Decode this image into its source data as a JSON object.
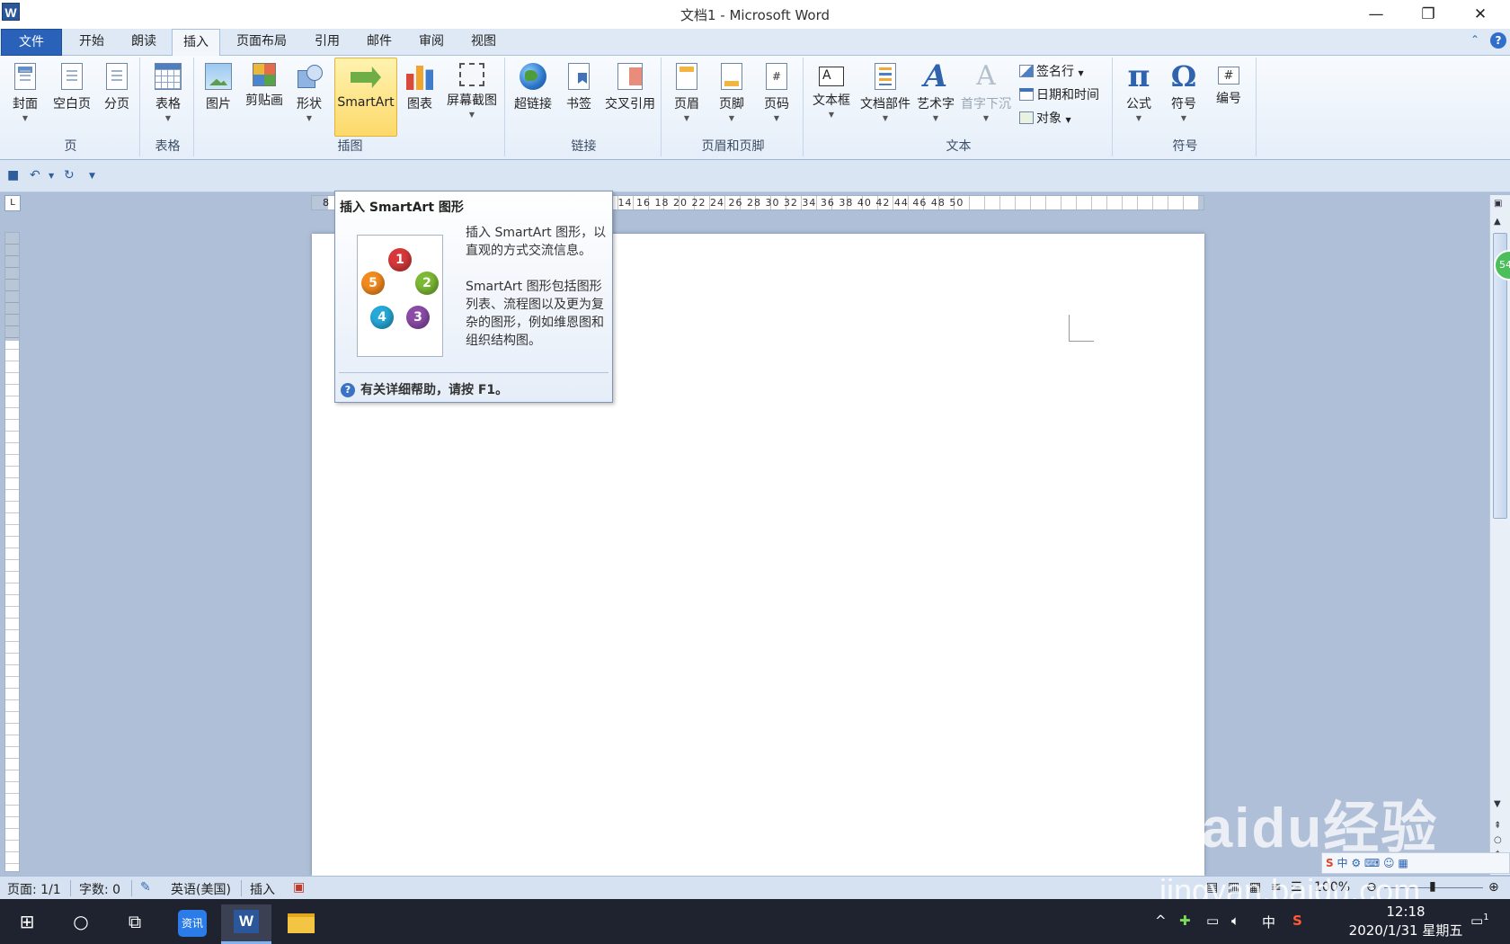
{
  "window": {
    "title": "文档1 - Microsoft Word",
    "app_icon": "W"
  },
  "tabs": [
    "文件",
    "开始",
    "朗读",
    "插入",
    "页面布局",
    "引用",
    "邮件",
    "审阅",
    "视图"
  ],
  "active_tab": "插入",
  "ribbon": {
    "groups": {
      "page": "页",
      "table": "表格",
      "illustrations": "插图",
      "links": "链接",
      "header_footer": "页眉和页脚",
      "text": "文本",
      "symbols": "符号"
    },
    "buttons": {
      "cover": "封面",
      "blank": "空白页",
      "page_break": "分页",
      "table": "表格",
      "picture": "图片",
      "clipart": "剪贴画",
      "shapes": "形状",
      "smartart": "SmartArt",
      "chart": "图表",
      "screenshot": "屏幕截图",
      "hyperlink": "超链接",
      "bookmark": "书签",
      "crossref": "交叉引用",
      "header": "页眉",
      "footer": "页脚",
      "page_number": "页码",
      "textbox": "文本框",
      "quickparts": "文档部件",
      "wordart": "艺术字",
      "dropcap": "首字下沉",
      "signature": "签名行",
      "datetime": "日期和时间",
      "object": "对象",
      "equation": "公式",
      "symbol": "符号",
      "number": "编号"
    }
  },
  "tooltip": {
    "title": "插入 SmartArt 图形",
    "desc1": "插入 SmartArt 图形，以直观的方式交流信息。",
    "desc2": "SmartArt 图形包括图形列表、流程图以及更为复杂的图形，例如维恩图和组织结构图。",
    "help": "有关详细帮助，请按 F1。",
    "balls": [
      "1",
      "2",
      "3",
      "4",
      "5"
    ]
  },
  "ruler": {
    "h_prefix": "8",
    "h_numbers": "12 14 16 18 20 22 24 26 28 30 32 34 36 38 40 42 44 46 48 50"
  },
  "status": {
    "page": "页面: 1/1",
    "words": "字数: 0",
    "language": "英语(美国)",
    "mode": "插入",
    "zoom": "100%"
  },
  "side_badge": "54",
  "watermark": {
    "main": "Baidu经验",
    "sub": "jingyan.baidu.com"
  },
  "ime": "中",
  "taskbar": {
    "news_label": "资讯",
    "tray_ime": "中",
    "time": "12:18",
    "date": "2020/1/31 星期五",
    "notify_count": "1"
  }
}
